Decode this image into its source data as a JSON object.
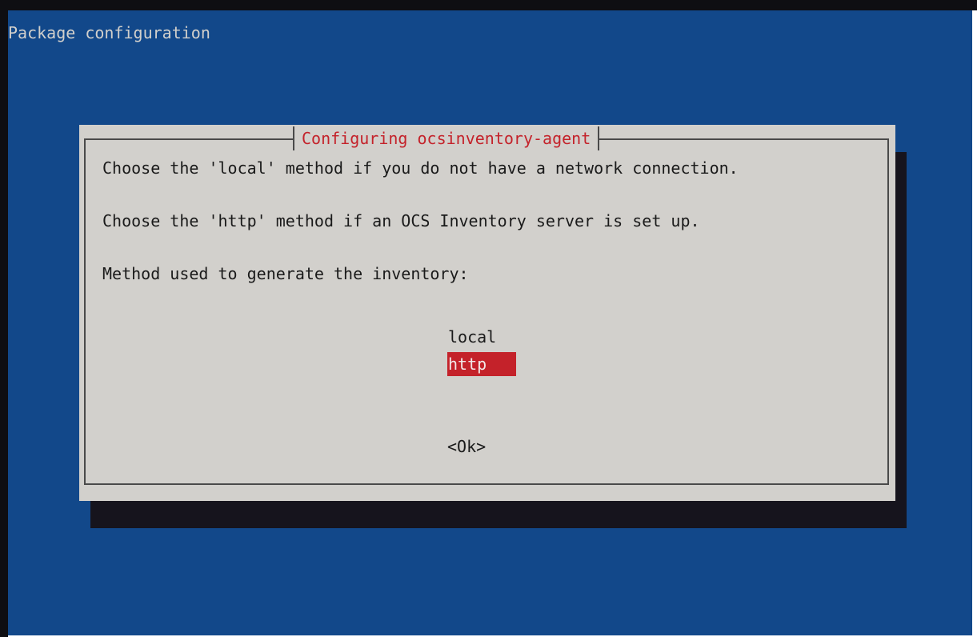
{
  "backtitle": "Package configuration",
  "dialog": {
    "title": "Configuring ocsinventory-agent",
    "lines": [
      "Choose the 'local' method if you do not have a network connection.",
      "Choose the 'http' method if an OCS Inventory server is set up.",
      "Method used to generate the inventory:"
    ],
    "choices": [
      {
        "label": "local",
        "selected": false
      },
      {
        "label": "http",
        "selected": true
      }
    ],
    "ok_label": "<Ok>"
  },
  "colors": {
    "background": "#12488a",
    "dialog": "#d2d0cc",
    "accent": "#c4222a",
    "shadow": "#16141d"
  }
}
